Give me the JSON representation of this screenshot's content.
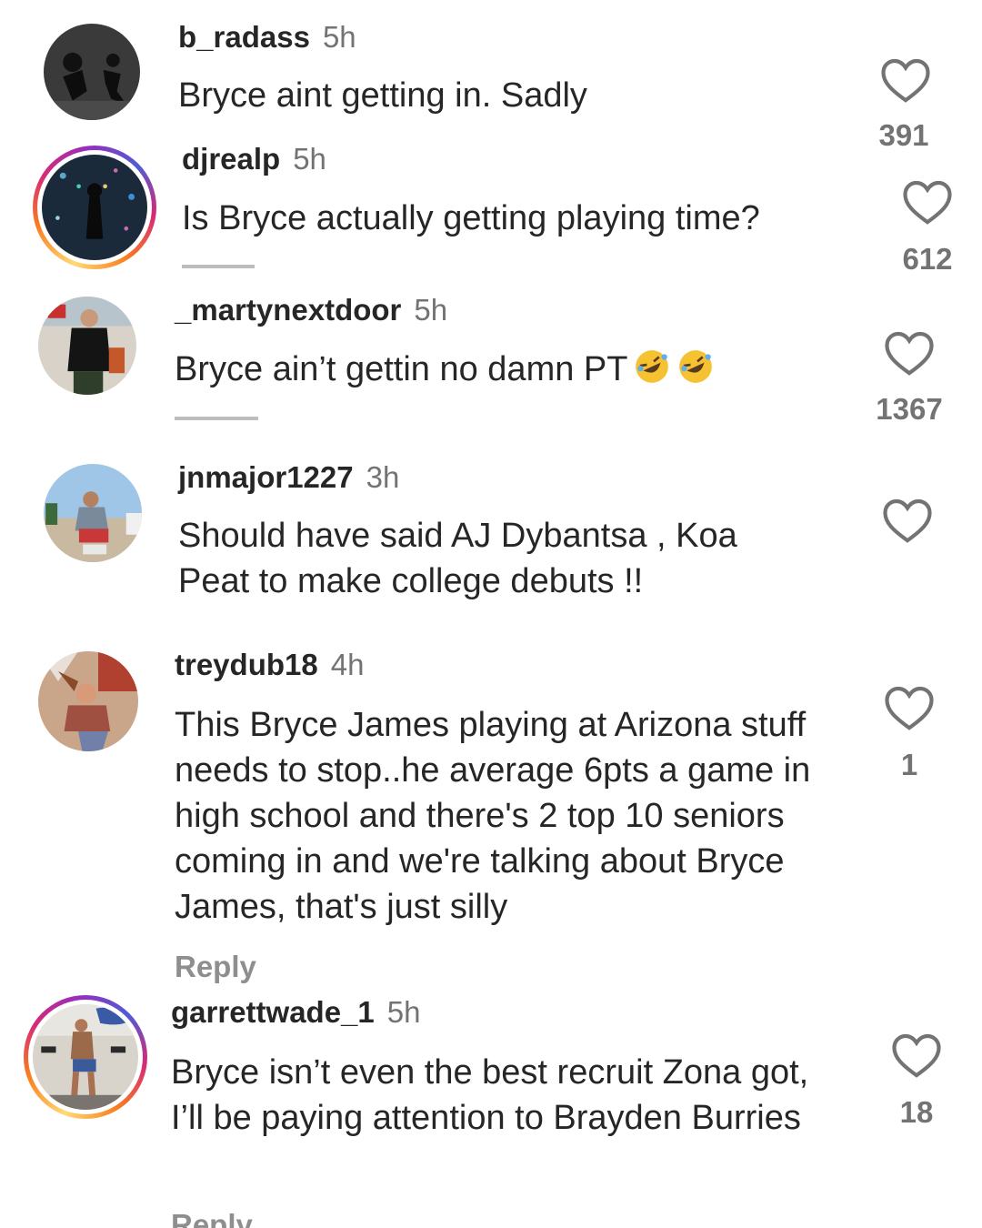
{
  "comments": [
    {
      "username": "b_radass",
      "time": "5h",
      "text": "Bryce aint getting in. Sadly",
      "likes": "391"
    },
    {
      "username": "djrealp",
      "time": "5h",
      "text": "Is Bryce actually getting playing time?",
      "likes": "612"
    },
    {
      "username": "_martynextdoor",
      "time": "5h",
      "text": "Bryce ain’t gettin no damn PT",
      "likes": "1367"
    },
    {
      "username": "jnmajor1227",
      "time": "3h",
      "text": "Should have said AJ Dybantsa , Koa Peat to make college debuts !!",
      "likes": ""
    },
    {
      "username": "treydub18",
      "time": "4h",
      "text": "This Bryce James playing at Arizona stuff needs to stop..he average 6pts a game in high school and there's 2 top 10 seniors coming in and we're talking about Bryce James, that's just silly",
      "likes": "1",
      "reply": "Reply"
    },
    {
      "username": "garrettwade_1",
      "time": "5h",
      "text": "Bryce isn’t even the best recruit Zona got, I’ll be paying attention to Brayden Burries",
      "likes": "18",
      "reply": "Reply"
    }
  ],
  "icons": {
    "like": "heart-outline-icon",
    "emoji": "rolling-on-floor-laughing-emoji"
  },
  "colors": {
    "text": "#262626",
    "secondary": "#737373",
    "reply": "#8e8e8e"
  }
}
